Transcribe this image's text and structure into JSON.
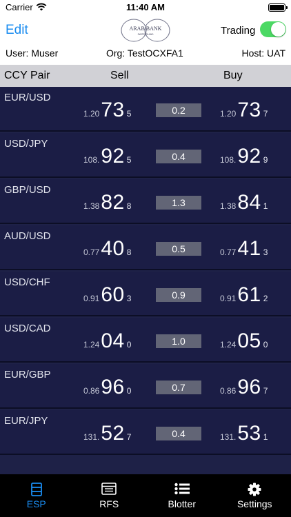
{
  "status": {
    "carrier": "Carrier",
    "time": "11:40 AM"
  },
  "nav": {
    "edit_label": "Edit",
    "logo_text": "ARAB BANK",
    "logo_subtext": "SWITZERLAND",
    "trading_label": "Trading",
    "trading_enabled": true
  },
  "info": {
    "user": "User: Muser",
    "org": "Org: TestOCXFA1",
    "host": "Host: UAT"
  },
  "columns": {
    "pair": "CCY Pair",
    "sell": "Sell",
    "buy": "Buy"
  },
  "rates": [
    {
      "pair": "EUR/USD",
      "sell_prefix": "1.20",
      "sell_big": "73",
      "sell_pip": "5",
      "spread": "0.2",
      "buy_prefix": "1.20",
      "buy_big": "73",
      "buy_pip": "7"
    },
    {
      "pair": "USD/JPY",
      "sell_prefix": "108.",
      "sell_big": "92",
      "sell_pip": "5",
      "spread": "0.4",
      "buy_prefix": "108.",
      "buy_big": "92",
      "buy_pip": "9"
    },
    {
      "pair": "GBP/USD",
      "sell_prefix": "1.38",
      "sell_big": "82",
      "sell_pip": "8",
      "spread": "1.3",
      "buy_prefix": "1.38",
      "buy_big": "84",
      "buy_pip": "1"
    },
    {
      "pair": "AUD/USD",
      "sell_prefix": "0.77",
      "sell_big": "40",
      "sell_pip": "8",
      "spread": "0.5",
      "buy_prefix": "0.77",
      "buy_big": "41",
      "buy_pip": "3"
    },
    {
      "pair": "USD/CHF",
      "sell_prefix": "0.91",
      "sell_big": "60",
      "sell_pip": "3",
      "spread": "0.9",
      "buy_prefix": "0.91",
      "buy_big": "61",
      "buy_pip": "2"
    },
    {
      "pair": "USD/CAD",
      "sell_prefix": "1.24",
      "sell_big": "04",
      "sell_pip": "0",
      "spread": "1.0",
      "buy_prefix": "1.24",
      "buy_big": "05",
      "buy_pip": "0"
    },
    {
      "pair": "EUR/GBP",
      "sell_prefix": "0.86",
      "sell_big": "96",
      "sell_pip": "0",
      "spread": "0.7",
      "buy_prefix": "0.86",
      "buy_big": "96",
      "buy_pip": "7"
    },
    {
      "pair": "EUR/JPY",
      "sell_prefix": "131.",
      "sell_big": "52",
      "sell_pip": "7",
      "spread": "0.4",
      "buy_prefix": "131.",
      "buy_big": "53",
      "buy_pip": "1"
    }
  ],
  "tabs": [
    {
      "label": "ESP",
      "icon": "esp-icon",
      "active": true
    },
    {
      "label": "RFS",
      "icon": "rfs-icon",
      "active": false
    },
    {
      "label": "Blotter",
      "icon": "list-icon",
      "active": false
    },
    {
      "label": "Settings",
      "icon": "gear-icon",
      "active": false
    }
  ],
  "colors": {
    "accent": "#1a8cf0",
    "toggle_on": "#4cd964",
    "rate_bg": "#1b1d45",
    "spread_bg": "#626576",
    "header_bg": "#d1d1d6"
  }
}
